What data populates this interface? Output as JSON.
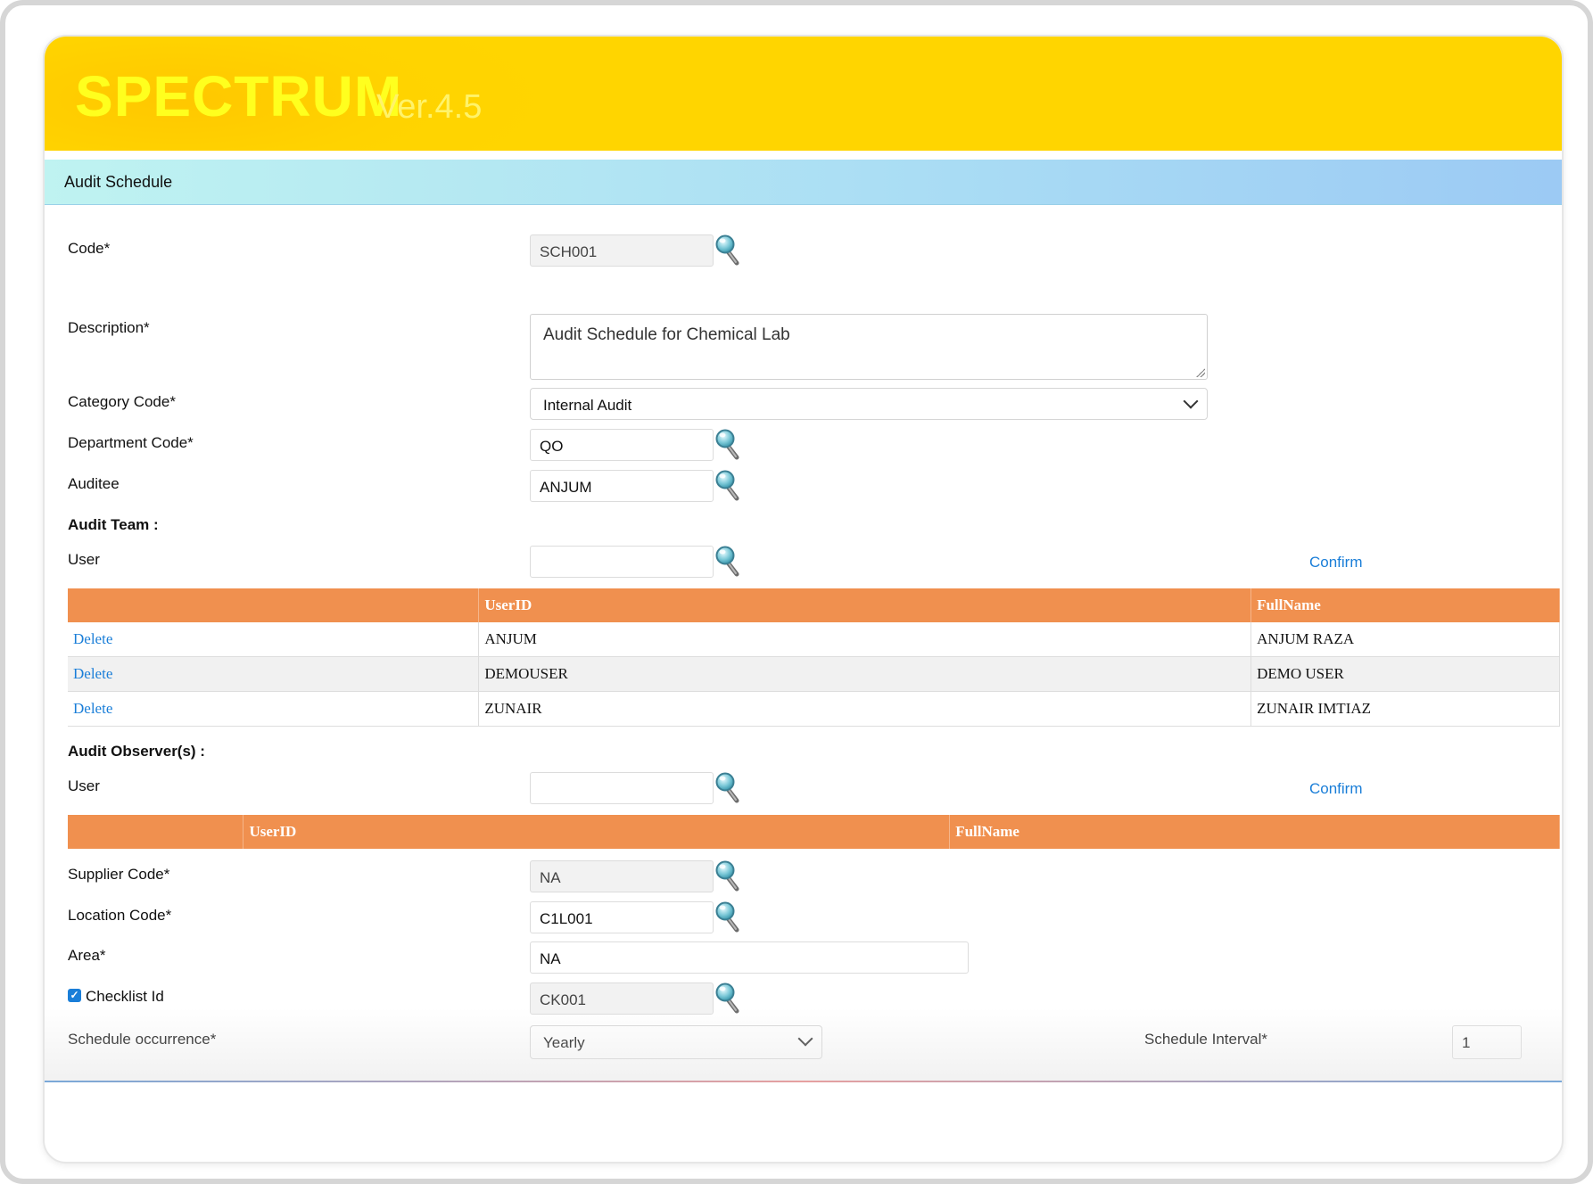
{
  "app": {
    "brand": "SPECTRUM",
    "version": "Ver.4.5"
  },
  "section": {
    "title": "Audit Schedule"
  },
  "form": {
    "code": {
      "label": "Code*",
      "value": "SCH001"
    },
    "description": {
      "label": "Description*",
      "value": "Audit Schedule for Chemical Lab"
    },
    "category_code": {
      "label": "Category Code*",
      "value": "Internal Audit"
    },
    "department_code": {
      "label": "Department Code*",
      "value": "QO"
    },
    "auditee": {
      "label": "Auditee",
      "value": "ANJUM"
    },
    "supplier_code": {
      "label": "Supplier Code*",
      "value": "NA"
    },
    "location_code": {
      "label": "Location Code*",
      "value": "C1L001"
    },
    "area": {
      "label": "Area*",
      "value": "NA"
    },
    "checklist_id": {
      "label": "Checklist Id",
      "value": "CK001",
      "checked": true
    },
    "schedule_occurrence": {
      "label": "Schedule occurrence*",
      "value": "Yearly"
    },
    "schedule_interval": {
      "label": "Schedule Interval*",
      "value": "1"
    }
  },
  "audit_team": {
    "heading": "Audit Team :",
    "user_label": "User",
    "user_value": "",
    "confirm_label": "Confirm",
    "columns": [
      "",
      "UserID",
      "FullName"
    ],
    "rows": [
      {
        "action": "Delete",
        "user_id": "ANJUM",
        "full_name": "ANJUM RAZA"
      },
      {
        "action": "Delete",
        "user_id": "DEMOUSER",
        "full_name": "DEMO USER"
      },
      {
        "action": "Delete",
        "user_id": "ZUNAIR",
        "full_name": "ZUNAIR IMTIAZ"
      }
    ]
  },
  "audit_observers": {
    "heading": "Audit Observer(s) :",
    "user_label": "User",
    "user_value": "",
    "confirm_label": "Confirm",
    "columns": [
      "",
      "UserID",
      "FullName"
    ],
    "rows": []
  },
  "icons": {
    "lookup": "magnifier-icon",
    "dropdown": "chevron-down-icon",
    "checkbox": "checkmark-icon"
  },
  "colors": {
    "banner": "#ffd300",
    "brand_text": "#ffff1e",
    "table_header": "#f0904f",
    "link": "#1a7ed8"
  }
}
